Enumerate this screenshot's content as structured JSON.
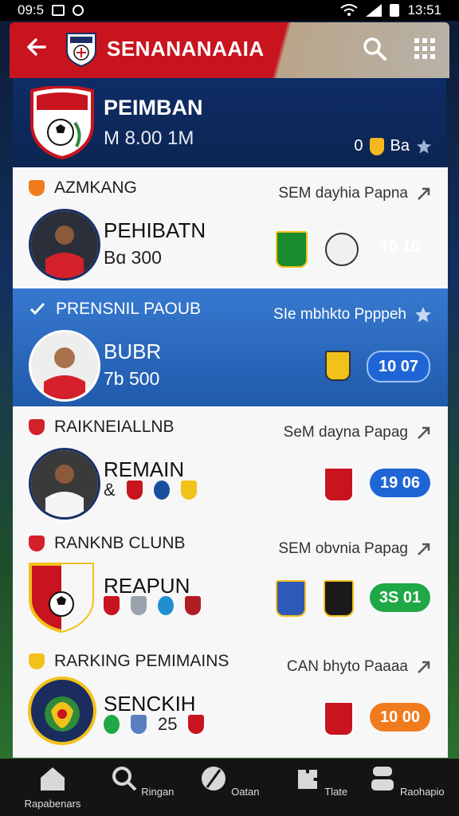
{
  "status_bar": {
    "time_left": "09:5",
    "time_right": "13:51"
  },
  "header": {
    "title": "SENANANAAIA",
    "back_icon": "arrow-left-icon",
    "search_icon": "search-icon",
    "menu_icon": "grid-icon"
  },
  "hero": {
    "name": "PEIMBAN",
    "value": "M 8.00 1M",
    "stat_value": "0",
    "stat_label": "Ba"
  },
  "cards": [
    {
      "category": "AZMKANG",
      "meta": "SEM dayhia Papna",
      "player_name": "PEHIBATN",
      "player_value": "Bɑ 300",
      "score": "10 10",
      "score_color": "#ef7b1d"
    },
    {
      "category": "PRENSNIL PAOUB",
      "meta": "SIe mbhkto Ppppeh",
      "player_name": "BUBR",
      "player_value": "7b 500",
      "score": "10 07",
      "score_color": "#1f65d6"
    },
    {
      "category": "RAIKNEIALLNB",
      "meta": "SeM dayna Papag",
      "player_name": "REMAIN",
      "badge_prefix": "&",
      "score": "19 06",
      "score_color": "#1f65d6"
    },
    {
      "category": "RANKNB CLUNB",
      "meta": "SEM obvnia Papag",
      "player_name": "REAPUN",
      "score": "3S 01",
      "score_color": "#1ea846"
    },
    {
      "category": "RARKING PEMIMAINS",
      "meta": "CAN bhyto Paaaa",
      "player_name": "SENCKIH",
      "badge_number": "25",
      "score": "10 00",
      "score_color": "#ef7b1d"
    }
  ],
  "bottom_nav": [
    {
      "label": "Rapabenars",
      "icon": "home-icon"
    },
    {
      "label": "Ringan",
      "icon": "search-icon"
    },
    {
      "label": "Oatan",
      "icon": "ball-icon"
    },
    {
      "label": "Tlate",
      "icon": "puzzle-icon"
    },
    {
      "label": "Raohapio",
      "icon": "profile-icon"
    }
  ],
  "colors": {
    "primary_red": "#c8141e",
    "navy": "#0e2c66",
    "active_blue": "#2e6fc7",
    "orange": "#ef7b1d",
    "green": "#1ea846"
  }
}
